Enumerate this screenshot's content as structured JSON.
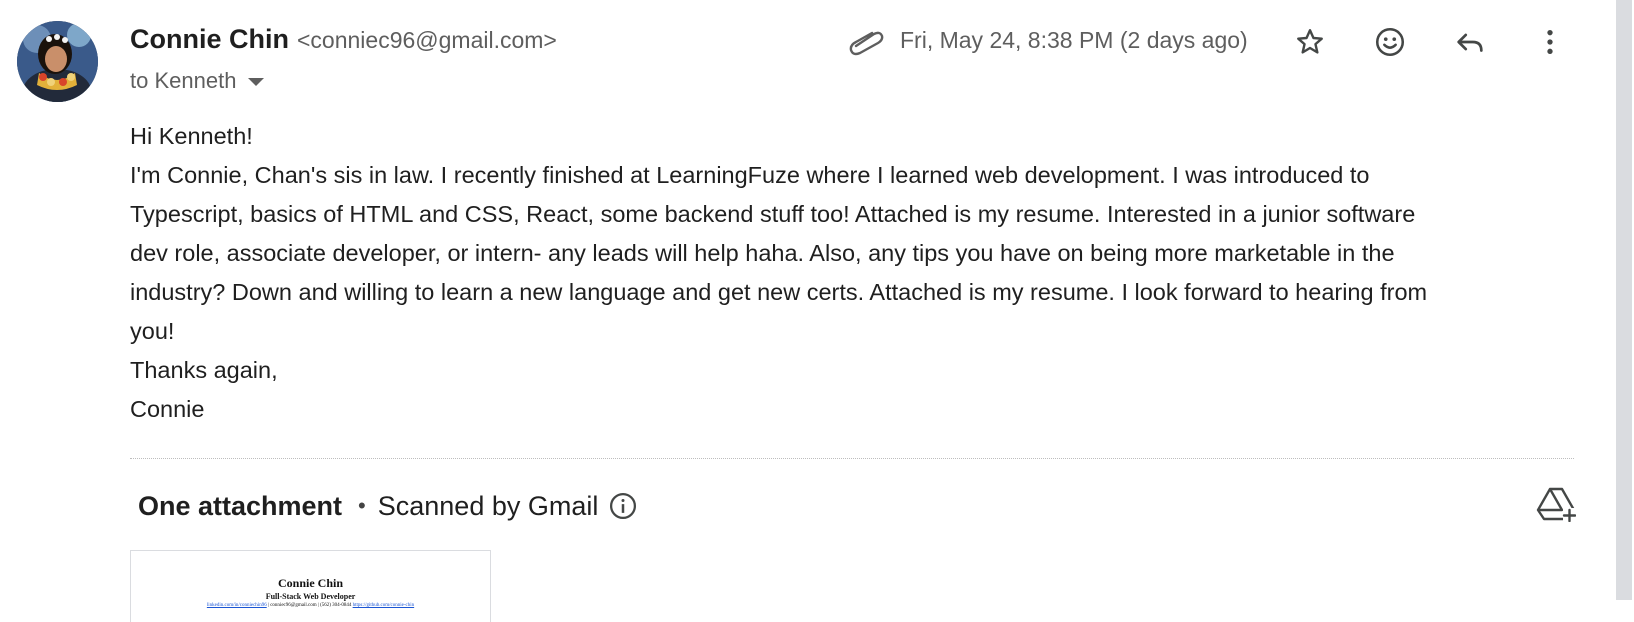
{
  "sender": {
    "name": "Connie Chin",
    "email": "<conniec96@gmail.com>"
  },
  "recipient": {
    "to_label": "to Kenneth"
  },
  "date": {
    "text": "Fri, May 24, 8:38 PM (2 days ago)"
  },
  "icons": {
    "attachment": "paperclip-icon",
    "star": "star-icon",
    "emoji": "emoji-icon",
    "reply": "reply-icon",
    "more": "more-vert-icon",
    "info": "info-icon",
    "drive": "add-to-drive-icon"
  },
  "body": {
    "lines": [
      "Hi Kenneth!",
      "I'm Connie, Chan's sis in law. I recently finished at LearningFuze where I learned web development. I was introduced to",
      "Typescript, basics of HTML and CSS, React, some backend stuff too! Attached is my resume. Interested in a junior software",
      "dev role, associate developer, or intern- any leads will help haha. Also, any tips you have on being more marketable in the",
      "industry? Down and willing to learn a new language and get new certs. Attached is my resume. I look forward to hearing from",
      "you!",
      "Thanks again,",
      "Connie"
    ]
  },
  "attachments": {
    "title": "One attachment",
    "separator": "•",
    "scanned": "Scanned by Gmail",
    "preview": {
      "name": "Connie Chin",
      "role": "Full-Stack Web Developer",
      "linkedin": "linkedin.com/in/conniechin96",
      "contact": " | conniec96@gmail.com | (562) 304-0844 ",
      "github": "https://github.com/connie-chin"
    }
  },
  "colors": {
    "text": "#1f1f1f",
    "secondary": "#5e5e5e",
    "link": "#1a55d4"
  }
}
